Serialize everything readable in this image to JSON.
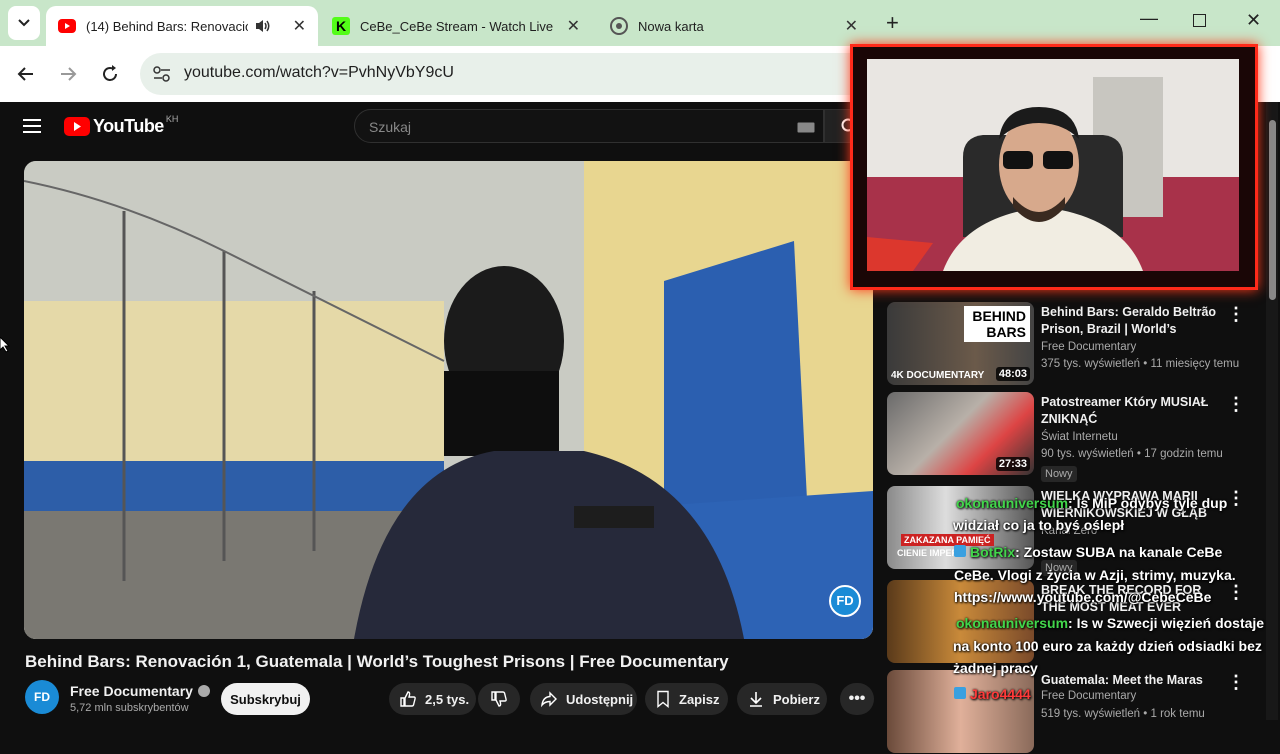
{
  "browser": {
    "tabs": [
      {
        "title": "(14) Behind Bars: Renovación 1",
        "active": true
      },
      {
        "title": "CeBe_CeBe Stream - Watch Live on",
        "active": false
      },
      {
        "title": "Nowa karta",
        "active": false
      }
    ],
    "url": "youtube.com/watch?v=PvhNyVbY9cU"
  },
  "youtube": {
    "logo": "YouTube",
    "region": "KH",
    "search_placeholder": "Szukaj",
    "video": {
      "title": "Behind Bars: Renovación 1, Guatemala | World’s Toughest Prisons | Free Documentary",
      "channel": "Free Documentary",
      "subscribers": "5,72 mln subskrybentów",
      "subscribe_label": "Subskrybuj",
      "likes": "2,5 tys.",
      "share_label": "Udostępnij",
      "save_label": "Zapisz",
      "download_label": "Pobierz"
    },
    "recommendations": [
      {
        "title": "Behind Bars: Geraldo Beltrão Prison, Brazil | World’s Toughe…",
        "channel": "Free Documentary",
        "meta": "375 tys. wyświetleń • 11 miesięcy temu",
        "duration": "48:03",
        "thumb_text": "BEHIND BARS",
        "thumb_sub": "4K DOCUMENTARY"
      },
      {
        "title": "Patostreamer Który MUSIAŁ ZNIKNĄĆ",
        "channel": "Świat Internetu",
        "meta": "90 tys. wyświetleń • 17 godzin temu",
        "duration": "27:33",
        "badge": "Nowy"
      },
      {
        "title": "WIELKA WYPRAWA MARII WIERNIKOWSKIEJ W GŁĄB …",
        "channel": "Kanał Zero",
        "meta": "",
        "duration": "",
        "badge": "Nowy",
        "thumb_text": "ZAKAZANA PAMIĘĆ",
        "thumb_sub": "CIENIE IMPERI"
      },
      {
        "title": "BREAK THE RECORD FOR THE MOST MEAT EVER EATEN TO …",
        "channel": "",
        "meta": "",
        "duration": ""
      },
      {
        "title": "Guatemala: Meet the Maras",
        "channel": "Free Documentary",
        "meta": "519 tys. wyświetleń • 1 rok temu",
        "duration": ""
      }
    ]
  },
  "chat": [
    {
      "user": "okonauniversum",
      "text": ": Is MiP odybys tyle dup"
    },
    {
      "user": "",
      "text": "widział co ja to byś oślepł"
    },
    {
      "user": "BotRix",
      "text": ": Zostaw SUBA na kanale CeBe"
    },
    {
      "user": "",
      "text": "CeBe. Vlogi z życia w Azji, strimy, muzyka."
    },
    {
      "user": "",
      "text": "https://www.youtube.com/@CebeCeBe"
    },
    {
      "user": "okonauniversum",
      "text": ": Is w Szwecji więzień dostaje"
    },
    {
      "user": "",
      "text": "na konto 100 euro za każdy dzień odsiadki bez"
    },
    {
      "user": "",
      "text": "żadnej pracy"
    },
    {
      "user": "Jaro4444",
      "text": ""
    }
  ]
}
